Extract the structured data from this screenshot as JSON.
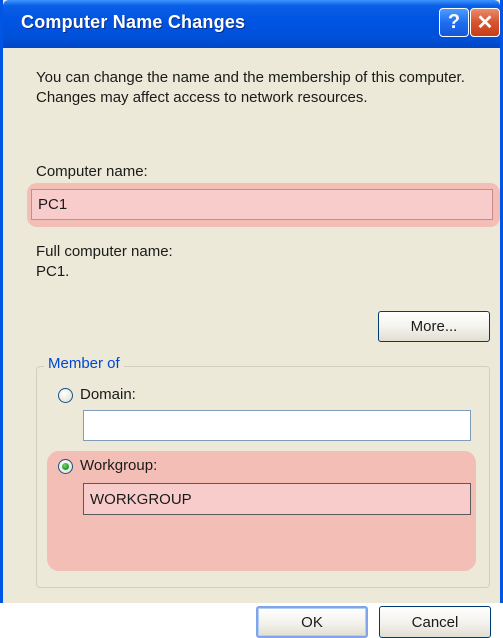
{
  "window": {
    "title": "Computer Name Changes",
    "help_glyph": "?",
    "close_glyph": "✕"
  },
  "intro": "You can change the name and the membership of this computer. Changes may affect access to network resources.",
  "computer_name": {
    "label": "Computer name:",
    "value": "PC1"
  },
  "full_name": {
    "label": "Full computer name:",
    "value": "PC1."
  },
  "more_button": "More...",
  "member_of": {
    "title": "Member of",
    "domain": {
      "label": "Domain:",
      "value": "",
      "selected": false
    },
    "workgroup": {
      "label": "Workgroup:",
      "value": "WORKGROUP",
      "selected": true
    }
  },
  "buttons": {
    "ok": "OK",
    "cancel": "Cancel"
  },
  "colors": {
    "titlebar": "#0054e3",
    "dialog_bg": "#ece9d8",
    "highlight": "#f3b6b0",
    "group_title": "#0046d5"
  }
}
